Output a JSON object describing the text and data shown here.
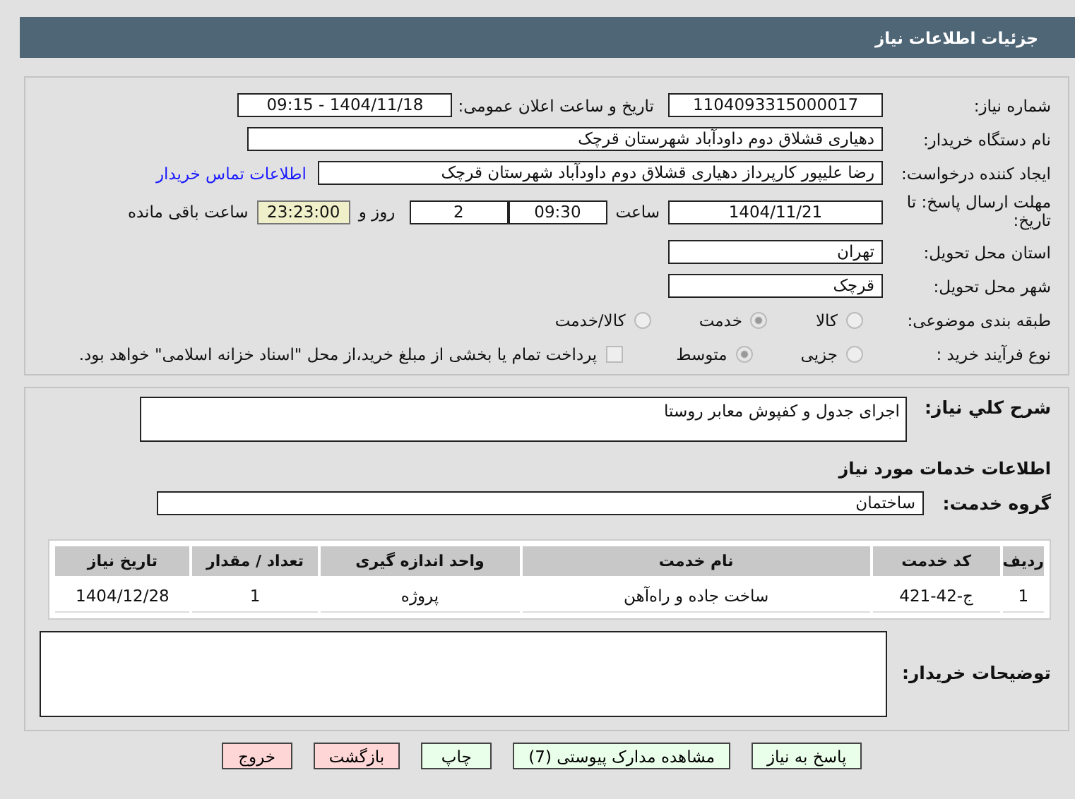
{
  "window": {
    "title": "جزئیات اطلاعات نیاز"
  },
  "need_number": {
    "label": "شماره نیاز:",
    "value": "1104093315000017"
  },
  "announce": {
    "label": "تاریخ و ساعت اعلان عمومی:",
    "value": "1404/11/18 - 09:15"
  },
  "buyer_org": {
    "label": "نام دستگاه خریدار:",
    "value": "دهیاری قشلاق دوم داودآباد شهرستان قرچک"
  },
  "requester": {
    "label": "ایجاد کننده درخواست:",
    "value": "رضا علیپور کارپرداز دهیاری قشلاق دوم داودآباد شهرستان قرچک",
    "link": "اطلاعات تماس خریدار"
  },
  "deadline": {
    "label": "مهلت ارسال پاسخ: تا تاریخ:",
    "date": "1404/11/21",
    "time_label": "ساعت",
    "time": "09:30",
    "days": "2",
    "days_label": "روز و",
    "remaining": "23:23:00",
    "remaining_label": "ساعت باقی مانده"
  },
  "province": {
    "label": "استان محل تحویل:",
    "value": "تهران"
  },
  "city": {
    "label": "شهر محل تحویل:",
    "value": "قرچک"
  },
  "category": {
    "label": "طبقه بندی موضوعی:",
    "options": [
      {
        "label": "کالا",
        "selected": false
      },
      {
        "label": "خدمت",
        "selected": true
      },
      {
        "label": "کالا/خدمت",
        "selected": false
      }
    ]
  },
  "process": {
    "label": "نوع فرآیند خرید :",
    "options": [
      {
        "label": "جزیی",
        "selected": false
      },
      {
        "label": "متوسط",
        "selected": true
      }
    ],
    "payment": {
      "checked": false,
      "text": "پرداخت تمام یا بخشی از مبلغ خرید،از محل \"اسناد خزانه اسلامی\" خواهد بود."
    }
  },
  "description": {
    "label": "شرح كلي نياز:",
    "value": "اجرای جدول و کفپوش معابر روستا"
  },
  "services_title": "اطلاعات خدمات مورد نیاز",
  "service_group": {
    "label": "گروه خدمت:",
    "value": "ساختمان"
  },
  "table": {
    "columns": [
      "ردیف",
      "کد خدمت",
      "نام خدمت",
      "واحد اندازه گیری",
      "تعداد / مقدار",
      "تاریخ نیاز"
    ],
    "rows": [
      [
        "1",
        "ج-42-421",
        "ساخت جاده و راه‌آهن",
        "پروژه",
        "1",
        "1404/12/28"
      ]
    ]
  },
  "buyer_notes": {
    "label": "توضیحات خریدار:"
  },
  "buttons": [
    {
      "label": "پاسخ به نیاز",
      "kind": "green"
    },
    {
      "label": "مشاهده مدارک پیوستی (7)",
      "kind": "green"
    },
    {
      "label": "چاپ",
      "kind": "green"
    },
    {
      "label": "بازگشت",
      "kind": "red"
    },
    {
      "label": "خروج",
      "kind": "red"
    }
  ]
}
